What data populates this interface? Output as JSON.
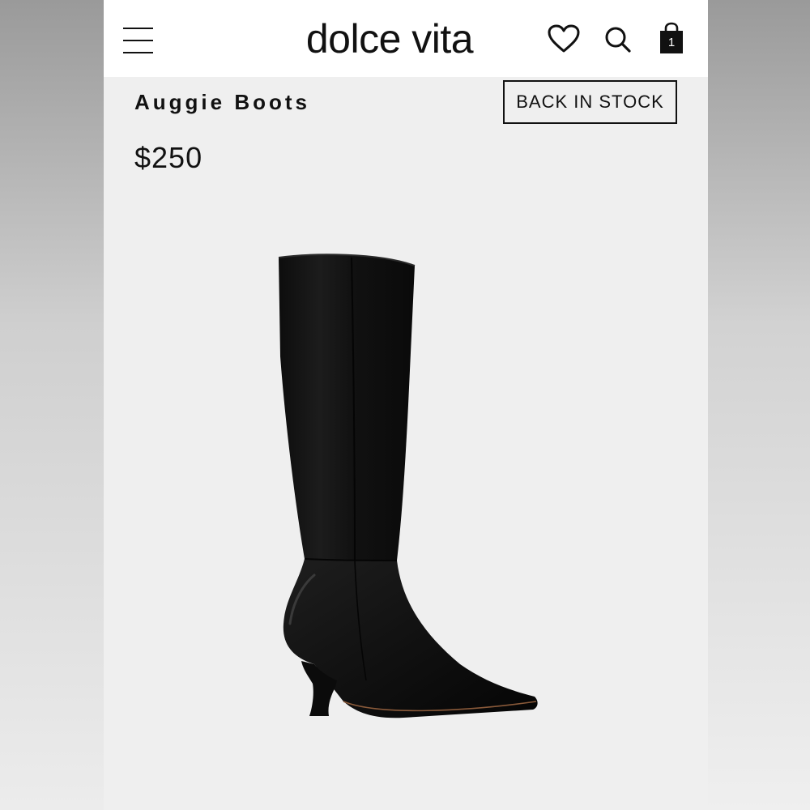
{
  "header": {
    "brand": "dolce vita",
    "menu_icon": "hamburger-menu-icon",
    "wishlist_icon": "heart-icon",
    "search_icon": "search-icon",
    "bag_icon": "shopping-bag-icon",
    "bag_count": "1"
  },
  "product": {
    "title": "Auggie Boots",
    "stock_badge": "BACK IN STOCK",
    "price": "$250",
    "image_icon": "black-knee-high-boot-image"
  },
  "colors": {
    "header_bg": "#ffffff",
    "page_bg": "#efefef",
    "text": "#111111",
    "boot": "#141414"
  }
}
